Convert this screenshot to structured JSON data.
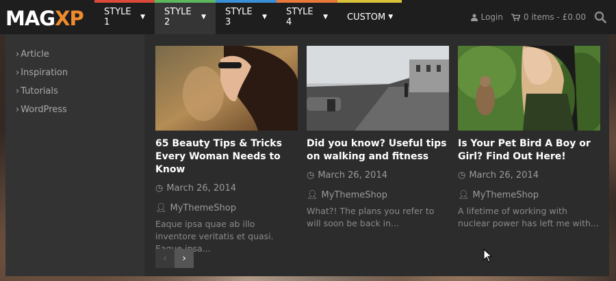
{
  "logo": {
    "main": "MAG",
    "accent": "XP"
  },
  "colors": {
    "navbar": "#1e1e1e",
    "accent": "#f08b2d",
    "style1_bar": "#d94a3a",
    "style2_bar": "#5cb85c",
    "style3_bar": "#3a8fd9",
    "style4_bar": "#e8793a",
    "custom_bar": "#d8c23a"
  },
  "menu": [
    {
      "label": "STYLE 1"
    },
    {
      "label": "STYLE 2"
    },
    {
      "label": "STYLE 3"
    },
    {
      "label": "STYLE 4"
    },
    {
      "label": "CUSTOM"
    }
  ],
  "header_right": {
    "login": "Login",
    "cart": "0 items - £0.00",
    "icons": [
      "user-icon",
      "cart-icon",
      "search-icon"
    ]
  },
  "categories": [
    {
      "label": "Article"
    },
    {
      "label": "Inspiration"
    },
    {
      "label": "Tutorials"
    },
    {
      "label": "WordPress"
    }
  ],
  "posts": [
    {
      "title": "65 Beauty Tips & Tricks Every Woman Needs to Know",
      "date": "March 26, 2014",
      "author": "MyThemeShop",
      "excerpt": "Eaque ipsa quae ab illo inventore veritatis et quasi. Eaque ipsa..."
    },
    {
      "title": "Did you know? Useful tips on walking and fitness",
      "date": "March 26, 2014",
      "author": "MyThemeShop",
      "excerpt": "What?! The plans you refer to will soon be back in..."
    },
    {
      "title": "Is Your Pet Bird A Boy or Girl? Find Out Here!",
      "date": "March 26, 2014",
      "author": "MyThemeShop",
      "excerpt": "A lifetime of working with nuclear power has left me with..."
    }
  ],
  "pager": {
    "prev": "‹",
    "next": "›"
  }
}
